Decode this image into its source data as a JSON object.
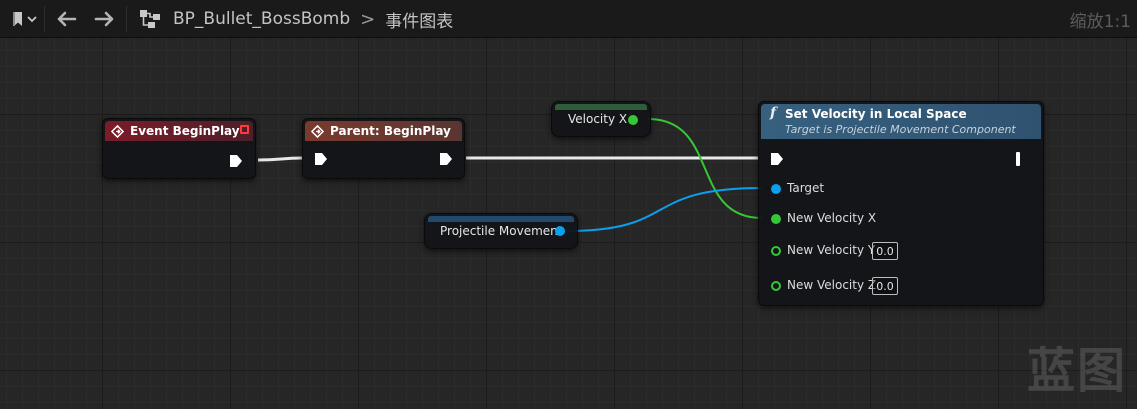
{
  "toolbar": {
    "asset_name": "BP_Bullet_BossBomb",
    "graph_name": "事件图表",
    "crumb_separator": ">",
    "zoom": "缩放1:1"
  },
  "nodes": {
    "event_begin_play": {
      "title": "Event BeginPlay"
    },
    "parent_begin_play": {
      "title": "Parent: BeginPlay"
    },
    "velocity_x": {
      "label": "Velocity X"
    },
    "projectile_movement": {
      "label": "Projectile Movement"
    },
    "set_velocity": {
      "title": "Set Velocity in Local Space",
      "subtitle": "Target is Projectile Movement Component",
      "func_glyph": "f",
      "pins": {
        "target": "Target",
        "new_velocity_x": "New Velocity X",
        "new_velocity_y": "New Velocity Y",
        "new_velocity_z": "New Velocity Z"
      },
      "defaults": {
        "y": "0.0",
        "z": "0.0"
      }
    }
  },
  "colors": {
    "exec_wire": "#e8e8e8",
    "float_wire": "#37c636",
    "object_wire": "#0aa0ee",
    "event_header": "#7c1c28",
    "function_header": "#37607f"
  },
  "watermark": "蓝图"
}
